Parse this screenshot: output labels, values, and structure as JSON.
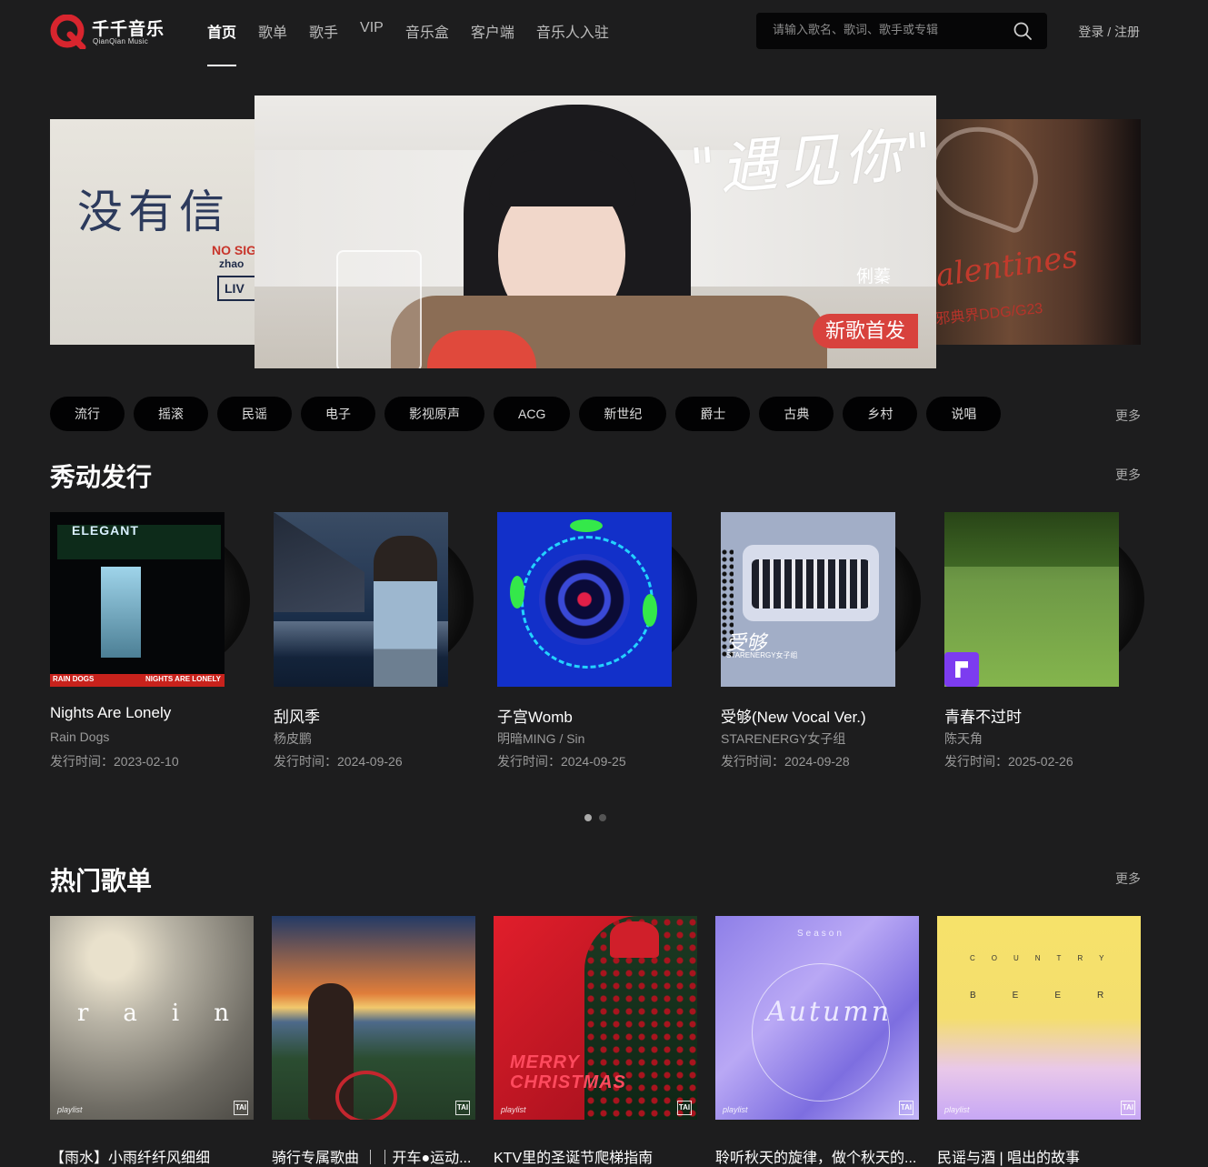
{
  "header": {
    "logo_cn": "千千音乐",
    "logo_en": "QianQian Music",
    "nav": [
      "首页",
      "歌单",
      "歌手",
      "VIP",
      "音乐盒",
      "客户端",
      "音乐人入驻"
    ],
    "active_nav": "首页",
    "search_placeholder": "请输入歌名、歌词、歌手或专辑",
    "login": "登录",
    "separator": "/",
    "register": "注册"
  },
  "banner": {
    "left": {
      "title": "没有信",
      "line1": "NO SIG",
      "line2": "zhao",
      "line3": "LIV"
    },
    "center": {
      "song_title": "\"遇见你\"",
      "artist": "俐蓁",
      "tag": "新歌首发"
    },
    "right": {
      "title": "alentines",
      "subtitle": "邪典界DDG/G23"
    }
  },
  "genres": {
    "items": [
      "流行",
      "摇滚",
      "民谣",
      "电子",
      "影视原声",
      "ACG",
      "新世纪",
      "爵士",
      "古典",
      "乡村",
      "说唱"
    ],
    "more": "更多"
  },
  "new_releases": {
    "title": "秀动发行",
    "more": "更多",
    "date_prefix": "发行时间：",
    "albums": [
      {
        "name": "Nights Are Lonely",
        "artist": "Rain Dogs",
        "date": "发行时间：2023-02-10",
        "cover": {
          "sign": "ELEGANT",
          "left_text": "RAIN DOGS",
          "right_text": "NIGHTS ARE LONELY"
        }
      },
      {
        "name": "刮风季",
        "artist": "杨皮鹏",
        "date": "发行时间：2024-09-26"
      },
      {
        "name": "子宫Womb",
        "artist": "明暗MING / Sin",
        "date": "发行时间：2024-09-25"
      },
      {
        "name": "受够(New Vocal Ver.)",
        "artist": "STARENERGY女子组",
        "date": "发行时间：2024-09-28",
        "cover": {
          "title": "受够",
          "subtitle": "STARENERGY女子组"
        }
      },
      {
        "name": "青春不过时",
        "artist": "陈天角",
        "date": "发行时间：2025-02-26"
      }
    ],
    "pagination": {
      "pages": 2,
      "current": 1
    }
  },
  "hot_playlists": {
    "title": "热门歌单",
    "more": "更多",
    "cover_label": "playlist",
    "cover_badge": "TAI",
    "playlists": [
      {
        "name": "【雨水】小雨纤纤风细细",
        "cover_text": "rain"
      },
      {
        "name": "骑行专属歌曲 ｜｜开车●运动...",
        "cover_text": ""
      },
      {
        "name": "KTV里的圣诞节爬梯指南",
        "cover_text": "MERRY CHRISTMAS"
      },
      {
        "name": "聆听秋天的旋律，做个秋天的...",
        "cover_text": "Autumn",
        "cover_sub": "Season"
      },
      {
        "name": "民谣与酒 | 唱出的故事",
        "cover_text": "COUNTRY",
        "cover_sub": "BEER"
      }
    ]
  },
  "colors": {
    "background": "#1d1d1e",
    "pill_bg": "#020203",
    "accent_red": "#d8423d"
  }
}
